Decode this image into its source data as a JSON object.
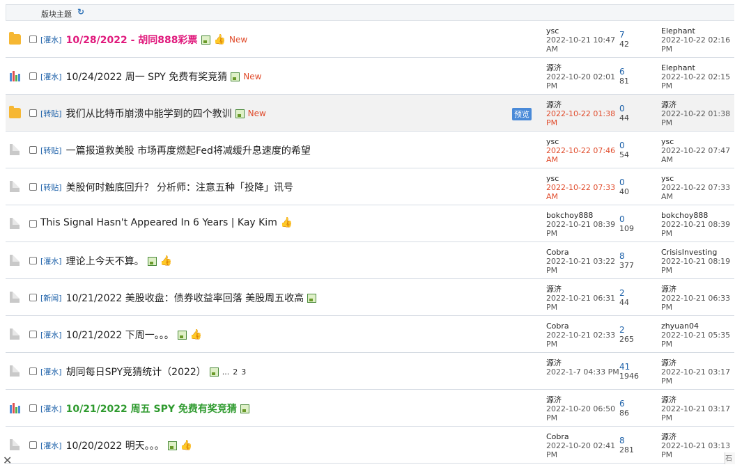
{
  "header": {
    "label": "版块主题",
    "refresh_icon": "refresh-icon"
  },
  "rows": [
    {
      "icon": "folder-orange",
      "tag": "[灌水]",
      "title": "10/28/2022 - 胡同888彩票",
      "title_style": "pink",
      "has_image": true,
      "has_thumb": true,
      "is_new": true,
      "new_label": "New",
      "preview": "",
      "pages": [],
      "author": "ysc",
      "post_date": "2022-10-21 10:47",
      "post_ampm": "AM",
      "date_red": false,
      "replies": "7",
      "views": "42",
      "last_user": "Elephant",
      "last_date": "2022-10-22 02:16",
      "last_ampm": "PM",
      "highlight": false
    },
    {
      "icon": "poll-bars",
      "tag": "[灌水]",
      "title": "10/24/2022 周一 SPY 免费有奖竞猜",
      "title_style": "normal",
      "has_image": true,
      "has_thumb": false,
      "is_new": true,
      "new_label": "New",
      "preview": "",
      "pages": [],
      "author": "源济",
      "post_date": "2022-10-20 02:01",
      "post_ampm": "PM",
      "date_red": false,
      "replies": "6",
      "views": "81",
      "last_user": "Elephant",
      "last_date": "2022-10-22 02:15",
      "last_ampm": "PM",
      "highlight": false
    },
    {
      "icon": "folder-orange",
      "tag": "[转贴]",
      "title": "我们从比特币崩溃中能学到的四个教训",
      "title_style": "normal",
      "has_image": true,
      "has_thumb": false,
      "is_new": true,
      "new_label": "New",
      "preview": "预览",
      "pages": [],
      "author": "源济",
      "post_date": "2022-10-22 01:38",
      "post_ampm": "PM",
      "date_red": true,
      "replies": "0",
      "views": "44",
      "last_user": "源济",
      "last_date": "2022-10-22 01:38",
      "last_ampm": "PM",
      "highlight": true
    },
    {
      "icon": "doc-gray",
      "tag": "[转贴]",
      "title": "一篇报道救美股 市场再度燃起Fed将减缓升息速度的希望",
      "title_style": "normal",
      "has_image": false,
      "has_thumb": false,
      "is_new": false,
      "new_label": "",
      "preview": "",
      "pages": [],
      "author": "ysc",
      "post_date": "2022-10-22 07:46",
      "post_ampm": "AM",
      "date_red": true,
      "replies": "0",
      "views": "54",
      "last_user": "ysc",
      "last_date": "2022-10-22 07:47",
      "last_ampm": "AM",
      "highlight": false
    },
    {
      "icon": "doc-gray",
      "tag": "[转贴]",
      "title": "美股何时触底回升？ 分析师：注意五种「投降」讯号",
      "title_style": "normal",
      "has_image": false,
      "has_thumb": false,
      "is_new": false,
      "new_label": "",
      "preview": "",
      "pages": [],
      "author": "ysc",
      "post_date": "2022-10-22 07:33",
      "post_ampm": "AM",
      "date_red": true,
      "replies": "0",
      "views": "40",
      "last_user": "ysc",
      "last_date": "2022-10-22 07:33",
      "last_ampm": "AM",
      "highlight": false
    },
    {
      "icon": "doc-gray",
      "tag": "",
      "title": "This Signal Hasn't Appeared In 6 Years | Kay Kim",
      "title_style": "normal",
      "has_image": false,
      "has_thumb": true,
      "is_new": false,
      "new_label": "",
      "preview": "",
      "pages": [],
      "author": "bokchoy888",
      "post_date": "2022-10-21 08:39",
      "post_ampm": "PM",
      "date_red": false,
      "replies": "0",
      "views": "109",
      "last_user": "bokchoy888",
      "last_date": "2022-10-21 08:39",
      "last_ampm": "PM",
      "highlight": false
    },
    {
      "icon": "doc-gray",
      "tag": "[灌水]",
      "title": "理论上今天不算。",
      "title_style": "normal",
      "has_image": true,
      "has_thumb": true,
      "is_new": false,
      "new_label": "",
      "preview": "",
      "pages": [],
      "author": "Cobra",
      "post_date": "2022-10-21 03:22",
      "post_ampm": "PM",
      "date_red": false,
      "replies": "8",
      "views": "377",
      "last_user": "CrisisInvesting",
      "last_date": "2022-10-21 08:19",
      "last_ampm": "PM",
      "highlight": false
    },
    {
      "icon": "doc-gray",
      "tag": "[新闻]",
      "title": "10/21/2022 美股收盘：债券收益率回落 美股周五收高",
      "title_style": "normal",
      "has_image": true,
      "has_thumb": false,
      "is_new": false,
      "new_label": "",
      "preview": "",
      "pages": [],
      "author": "源济",
      "post_date": "2022-10-21 06:31",
      "post_ampm": "PM",
      "date_red": false,
      "replies": "2",
      "views": "44",
      "last_user": "源济",
      "last_date": "2022-10-21 06:33",
      "last_ampm": "PM",
      "highlight": false
    },
    {
      "icon": "doc-gray",
      "tag": "[灌水]",
      "title": "10/21/2022 下周一。。。",
      "title_style": "normal",
      "has_image": true,
      "has_thumb": true,
      "is_new": false,
      "new_label": "",
      "preview": "",
      "pages": [],
      "author": "Cobra",
      "post_date": "2022-10-21 02:33",
      "post_ampm": "PM",
      "date_red": false,
      "replies": "2",
      "views": "265",
      "last_user": "zhyuan04",
      "last_date": "2022-10-21 05:35",
      "last_ampm": "PM",
      "highlight": false
    },
    {
      "icon": "doc-gray",
      "tag": "[灌水]",
      "title": "胡同每日SPY竞猜统计（2022）",
      "title_style": "normal",
      "has_image": true,
      "has_thumb": false,
      "is_new": false,
      "new_label": "",
      "preview": "",
      "pages": [
        "...",
        "2",
        "3"
      ],
      "author": "源济",
      "post_date": "2022-1-7 04:33 PM",
      "post_ampm": "",
      "date_red": false,
      "replies": "41",
      "views": "1946",
      "last_user": "源济",
      "last_date": "2022-10-21 03:17",
      "last_ampm": "PM",
      "highlight": false
    },
    {
      "icon": "poll-bars",
      "tag": "[灌水]",
      "title": "10/21/2022 周五 SPY 免费有奖竞猜",
      "title_style": "green",
      "has_image": true,
      "has_thumb": false,
      "is_new": false,
      "new_label": "",
      "preview": "",
      "pages": [],
      "author": "源济",
      "post_date": "2022-10-20 06:50",
      "post_ampm": "PM",
      "date_red": false,
      "replies": "6",
      "views": "86",
      "last_user": "源济",
      "last_date": "2022-10-21 03:17",
      "last_ampm": "PM",
      "highlight": false
    },
    {
      "icon": "doc-gray",
      "tag": "[灌水]",
      "title": "10/20/2022 明天。。。",
      "title_style": "normal",
      "has_image": true,
      "has_thumb": true,
      "is_new": false,
      "new_label": "",
      "preview": "",
      "pages": [],
      "author": "Cobra",
      "post_date": "2022-10-20 02:41",
      "post_ampm": "PM",
      "date_red": false,
      "replies": "8",
      "views": "281",
      "last_user": "源济",
      "last_date": "2022-10-21 03:13",
      "last_ampm": "PM",
      "highlight": false
    }
  ],
  "colors": {
    "pink": "#e0197c",
    "green": "#2e9a2e",
    "link": "#1a5fa8",
    "new": "#e04a2a"
  },
  "footer": {
    "close_icon": "close-icon",
    "corner_label": "石"
  }
}
